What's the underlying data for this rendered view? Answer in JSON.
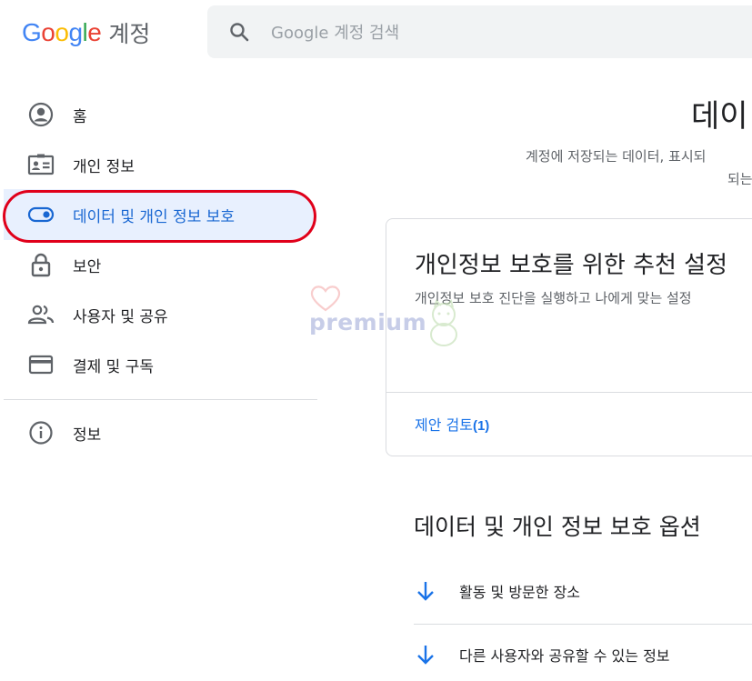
{
  "header": {
    "logo_letters": [
      {
        "ch": "G",
        "color": "#4285f4"
      },
      {
        "ch": "o",
        "color": "#ea4335"
      },
      {
        "ch": "o",
        "color": "#fbbc05"
      },
      {
        "ch": "g",
        "color": "#4285f4"
      },
      {
        "ch": "l",
        "color": "#34a853"
      },
      {
        "ch": "e",
        "color": "#ea4335"
      }
    ],
    "product": "계정",
    "search_placeholder": "Google 계정 검색"
  },
  "sidebar": {
    "items": [
      {
        "label": "홈",
        "icon": "account-circle-icon"
      },
      {
        "label": "개인 정보",
        "icon": "id-card-icon"
      },
      {
        "label": "데이터 및 개인 정보 보호",
        "icon": "toggle-icon",
        "active": true
      },
      {
        "label": "보안",
        "icon": "lock-icon"
      },
      {
        "label": "사용자 및 공유",
        "icon": "people-icon"
      },
      {
        "label": "결제 및 구독",
        "icon": "credit-card-icon"
      }
    ],
    "info": {
      "label": "정보",
      "icon": "info-icon"
    }
  },
  "main": {
    "title": "데이",
    "subtitle_line1": "계정에 저장되는 데이터, 표시되",
    "subtitle_line2": "되는",
    "card": {
      "title": "개인정보 보호를 위한 추천 설정",
      "description": "개인정보 보호 진단을 실행하고 나에게 맞는 설정",
      "link_label": "제안 검토",
      "link_count": "(1)"
    },
    "section_title": "데이터 및 개인 정보 보호 옵션",
    "options": [
      {
        "label": "활동 및 방문한 장소"
      },
      {
        "label": "다른 사용자와 공유할 수 있는 정보"
      }
    ]
  },
  "watermark": {
    "text": "premium"
  },
  "colors": {
    "accent_blue": "#1a73e8",
    "active_bg": "#e8f0fe",
    "highlight_ring": "#e0001a"
  }
}
